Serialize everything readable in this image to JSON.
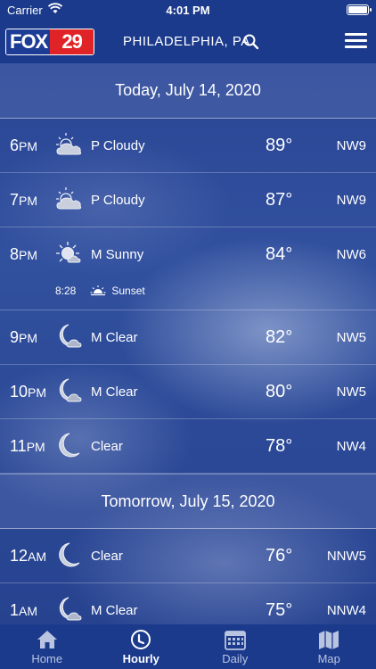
{
  "status_bar": {
    "carrier": "Carrier",
    "time": "4:01 PM"
  },
  "header": {
    "logo_left": "FOX",
    "logo_right": "29",
    "location": "PHILADELPHIA, PA"
  },
  "days": [
    {
      "label": "Today, July 14, 2020",
      "hours": [
        {
          "hour": "6",
          "ampm": "PM",
          "icon": "partly-cloudy-icon",
          "condition": "P Cloudy",
          "temp": "89°",
          "wind": "NW9"
        },
        {
          "hour": "7",
          "ampm": "PM",
          "icon": "partly-cloudy-icon",
          "condition": "P Cloudy",
          "temp": "87°",
          "wind": "NW9"
        },
        {
          "hour": "8",
          "ampm": "PM",
          "icon": "mostly-sunny-icon",
          "condition": "M Sunny",
          "temp": "84°",
          "wind": "NW6",
          "sunset_time": "8:28",
          "sunset_label": "Sunset"
        },
        {
          "hour": "9",
          "ampm": "PM",
          "icon": "mostly-clear-night-icon",
          "condition": "M Clear",
          "temp": "82°",
          "wind": "NW5"
        },
        {
          "hour": "10",
          "ampm": "PM",
          "icon": "mostly-clear-night-icon",
          "condition": "M Clear",
          "temp": "80°",
          "wind": "NW5"
        },
        {
          "hour": "11",
          "ampm": "PM",
          "icon": "clear-night-icon",
          "condition": "Clear",
          "temp": "78°",
          "wind": "NW4"
        }
      ]
    },
    {
      "label": "Tomorrow, July 15, 2020",
      "hours": [
        {
          "hour": "12",
          "ampm": "AM",
          "icon": "clear-night-icon",
          "condition": "Clear",
          "temp": "76°",
          "wind": "NNW5"
        },
        {
          "hour": "1",
          "ampm": "AM",
          "icon": "mostly-clear-night-icon",
          "condition": "M Clear",
          "temp": "75°",
          "wind": "NNW4"
        }
      ]
    }
  ],
  "tabs": [
    {
      "label": "Home",
      "icon": "home-icon",
      "active": false
    },
    {
      "label": "Hourly",
      "icon": "clock-icon",
      "active": true
    },
    {
      "label": "Daily",
      "icon": "calendar-icon",
      "active": false
    },
    {
      "label": "Map",
      "icon": "map-icon",
      "active": false
    }
  ]
}
